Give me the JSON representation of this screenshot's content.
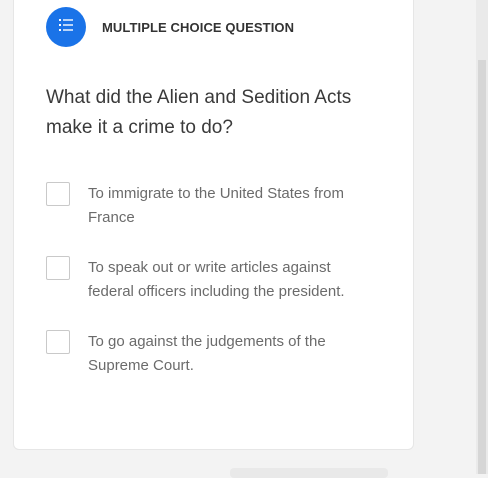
{
  "question_card": {
    "type_icon": "list-icon",
    "type_label": "Multiple Choice Question",
    "question_text": "What did the Alien and Sedition Acts make it a crime to do?",
    "options": [
      {
        "label": "To immigrate to the United States from France",
        "checked": false
      },
      {
        "label": "To speak out or write articles against federal officers including the president.",
        "checked": false
      },
      {
        "label": "To go against the judgements of the Supreme Court.",
        "checked": false
      }
    ]
  },
  "colors": {
    "accent": "#1a73e8",
    "text_primary": "#3a3a3a",
    "text_secondary": "#6b6b6b",
    "checkbox_border": "#c9c9c9"
  }
}
